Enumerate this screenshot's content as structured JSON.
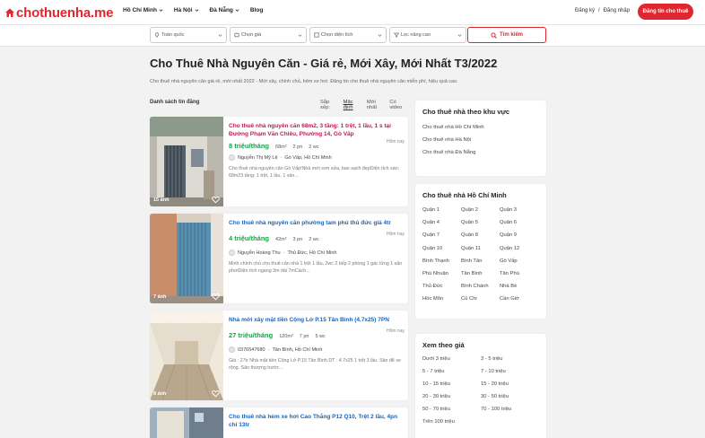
{
  "header": {
    "logo_text": "chothuenha.me",
    "nav": [
      "Hồ Chí Minh",
      "Hà Nội",
      "Đà Nẵng",
      "Blog"
    ],
    "register": "Đăng ký",
    "separator": "/",
    "login": "Đăng nhập",
    "post_button": "Đăng tin cho thuê",
    "brand_color": "#e02730"
  },
  "search": {
    "location": "Toàn quốc",
    "price": "Chọn giá",
    "area": "Chọn diện tích",
    "advanced": "Lọc nâng cao",
    "button": "Tìm kiếm"
  },
  "page": {
    "title": "Cho Thuê Nhà Nguyên Căn - Giá rẻ, Mới Xây, Mới Nhất T3/2022",
    "description": "Cho thuê nhà nguyên căn giá rẻ, mới nhất 2022 - Mới xây, chính chủ, hẻm xe hơi. Đăng tin cho thuê nhà nguyên căn miễn phí, hiệu quả cao."
  },
  "list": {
    "heading": "Danh sách tin đăng",
    "sort_label": "Sắp xếp:",
    "sort_options": [
      "Mặc định",
      "Mới nhất",
      "Có video"
    ],
    "items": [
      {
        "title": "Cho thuê nhà nguyên căn 68m2, 3 tầng: 1 trệt, 1 lầu, 1 s tại Đường Phạm Văn Chiêu, Phường 14, Gò Vấp",
        "price": "8 triệu/tháng",
        "area": "68m²",
        "bedrooms": "2 pn",
        "bathrooms": "2 wc",
        "time": "Hôm nay",
        "owner": "Nguyễn Thị Mỹ Lệ",
        "location": "Gò Vấp, Hồ Chí Minh",
        "excerpt": "Cho thuê nhà nguyên căn Gò Vấp!Nhà mới sơn sửa, bao sạch đẹpDiện tích sàn: 68m23 tầng: 1 trệt, 1 lầu, 1 sân...",
        "photos": "15 ảnh"
      },
      {
        "title": "Cho thuê nhà nguyên căn phường tam phú thủ đức giá 4tr",
        "price": "4 triệu/tháng",
        "area": "42m²",
        "bedrooms": "3 pn",
        "bathrooms": "2 wc",
        "time": "Hôm nay",
        "owner": "Nguyễn Hoàng Thu",
        "location": "Thủ Đức, Hồ Chí Minh",
        "excerpt": "Minh chính chủ cho thuê căn nhà 1 trệt 1 lầu, 2wc 2 bếp 2 phòng 1 gác lửng 1 sân phơiDiện tích ngang 3m dài 7mCách...",
        "photos": "7 ảnh"
      },
      {
        "title": "Nhà mới xây mặt tiền Cộng Lở P.15 Tân Bình (4.7x25) 7PN",
        "price": "27 triệu/tháng",
        "area": "120m²",
        "bedrooms": "7 pn",
        "bathrooms": "5 wc",
        "time": "Hôm nay",
        "owner": "0376547680",
        "location": "Tân Bình, Hồ Chí Minh",
        "excerpt": "Giá : 27tr Nhà mặt tiền Cộng Lở P.15 Tân Bình DT : 4.7x25 1 trệt 3 lầu. Sân để xe rộng. Sân thượng trước...",
        "photos": "8 ảnh"
      },
      {
        "title": "Cho thuê nhà hẻm xe hơi Cao Thắng P12 Q10, Trệt 2 lầu, 4pn chỉ 13tr"
      }
    ]
  },
  "sidebar": {
    "region": {
      "title": "Cho thuê nhà theo khu vực",
      "links": [
        "Cho thuê nhà Hồ Chí Minh",
        "Cho thuê nhà Hà Nội",
        "Cho thuê nhà Đà Nẵng"
      ]
    },
    "hcm": {
      "title": "Cho thuê nhà Hồ Chí Minh",
      "districts": [
        "Quận 1",
        "Quận 2",
        "Quận 3",
        "Quận 4",
        "Quận 5",
        "Quận 6",
        "Quận 7",
        "Quận 8",
        "Quận 9",
        "Quận 10",
        "Quận 11",
        "Quận 12",
        "Bình Thạnh",
        "Bình Tân",
        "Gò Vấp",
        "Phú Nhuận",
        "Tân Bình",
        "Tân Phú",
        "Thủ Đức",
        "Bình Chánh",
        "Nhà Bè",
        "Hóc Môn",
        "Củ Chi",
        "Cần Giờ"
      ]
    },
    "price": {
      "title": "Xem theo giá",
      "ranges": [
        "Dưới 3 triệu",
        "3 - 5 triệu",
        "5 - 7 triệu",
        "7 - 10 triệu",
        "10 - 15 triệu",
        "15 - 20 triệu",
        "20 - 30 triệu",
        "30 - 50 triệu",
        "50 - 70 triệu",
        "70 - 100 triệu",
        "Trên 100 triệu"
      ]
    }
  }
}
